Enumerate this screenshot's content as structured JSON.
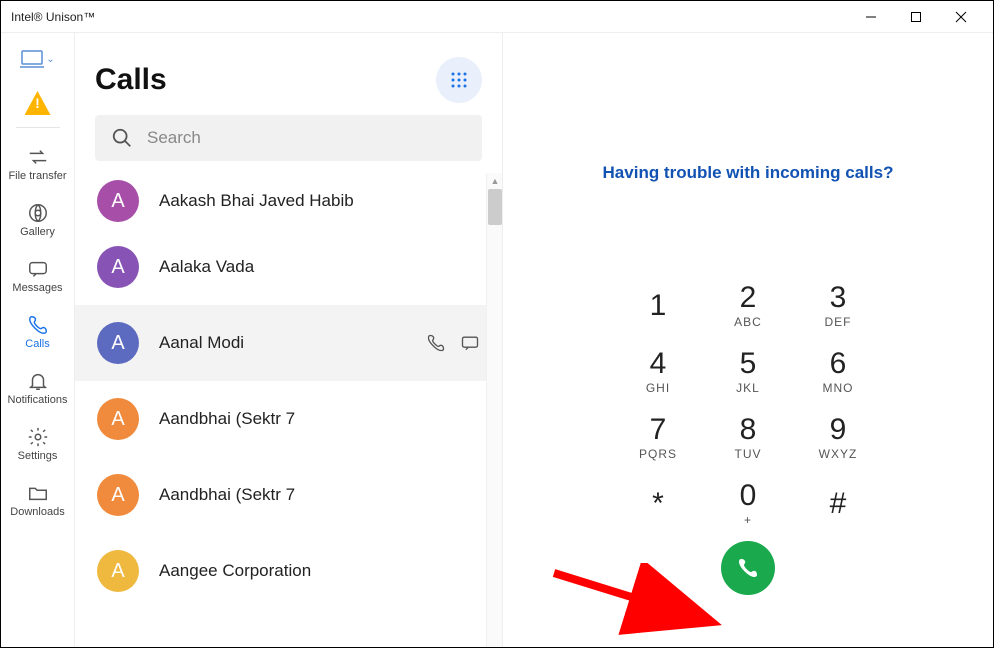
{
  "window": {
    "title": "Intel® Unison™"
  },
  "sidebar": {
    "alert": "!",
    "items": [
      {
        "label": "File transfer"
      },
      {
        "label": "Gallery"
      },
      {
        "label": "Messages"
      },
      {
        "label": "Calls"
      },
      {
        "label": "Notifications"
      },
      {
        "label": "Settings"
      },
      {
        "label": "Downloads"
      }
    ]
  },
  "list": {
    "title": "Calls",
    "search_placeholder": "Search",
    "contacts": [
      {
        "initial": "A",
        "name": "Aakash Bhai Javed Habib",
        "color": "#a64ea8"
      },
      {
        "initial": "A",
        "name": "Aalaka Vada",
        "color": "#8754b5"
      },
      {
        "initial": "A",
        "name": "Aanal Modi",
        "color": "#5c6bc0",
        "active": true
      },
      {
        "initial": "A",
        "name": "Aandbhai (Sektr 7",
        "color": "#f08a3c"
      },
      {
        "initial": "A",
        "name": "Aandbhai (Sektr 7",
        "color": "#f08a3c"
      },
      {
        "initial": "A",
        "name": "Aangee Corporation",
        "color": "#efb93f"
      }
    ]
  },
  "dialer": {
    "trouble_link": "Having trouble with incoming calls?",
    "keys": [
      {
        "digit": "1",
        "letters": ""
      },
      {
        "digit": "2",
        "letters": "ABC"
      },
      {
        "digit": "3",
        "letters": "DEF"
      },
      {
        "digit": "4",
        "letters": "GHI"
      },
      {
        "digit": "5",
        "letters": "JKL"
      },
      {
        "digit": "6",
        "letters": "MNO"
      },
      {
        "digit": "7",
        "letters": "PQRS"
      },
      {
        "digit": "8",
        "letters": "TUV"
      },
      {
        "digit": "9",
        "letters": "WXYZ"
      },
      {
        "digit": "*",
        "letters": ""
      },
      {
        "digit": "0",
        "letters": "+"
      },
      {
        "digit": "#",
        "letters": ""
      }
    ]
  }
}
